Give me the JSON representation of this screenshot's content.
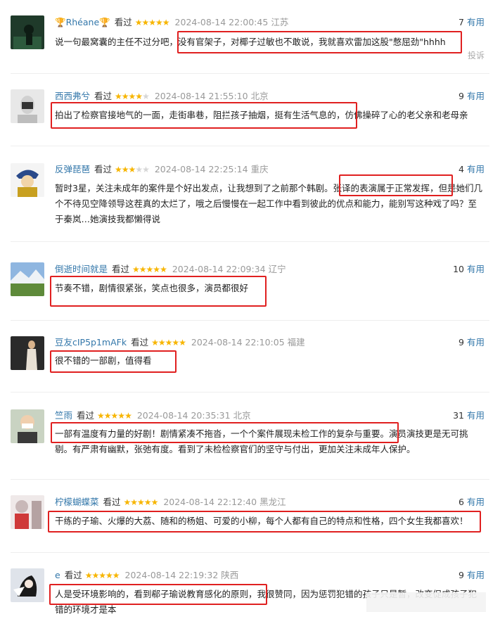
{
  "comments": [
    {
      "user": "Rhéane",
      "badge_icons": [
        "trophy-icon",
        "trophy-icon"
      ],
      "status": "看过",
      "stars": 5,
      "time": "2024-08-14 22:00:45",
      "location": "江苏",
      "useful_count": "7",
      "useful_label": "有用",
      "text": "说一句最窝囊的主任不过分吧，没有官架子，对椰子过敏也不敢说，我就喜欢雷加这股\"憋屈劲\"hhhh",
      "report": "投诉"
    },
    {
      "user": "西西弗兮",
      "status": "看过",
      "stars": 4,
      "time": "2024-08-14 21:55:10",
      "location": "北京",
      "useful_count": "9",
      "useful_label": "有用",
      "text": "拍出了检察官接地气的一面，走街串巷，阻拦孩子抽烟，挺有生活气息的，仿佛操碎了心的老父亲和老母亲"
    },
    {
      "user": "反弹琵琶",
      "status": "看过",
      "stars": 3,
      "time": "2024-08-14 22:25:14",
      "location": "重庆",
      "useful_count": "4",
      "useful_label": "有用",
      "text": "暂时3星，关注未成年的案件是个好出发点，让我想到了之前那个韩剧。张译的表演属于正常发挥，但是她们几个不待见空降领导这茬真的太烂了，哦之后慢慢在一起工作中看到彼此的优点和能力，能别写这种戏了吗？至于秦岚…她演技我都懒得说"
    },
    {
      "user": "倒逝时间就是",
      "status": "看过",
      "stars": 5,
      "time": "2024-08-14 22:09:34",
      "location": "辽宁",
      "useful_count": "10",
      "useful_label": "有用",
      "text": "节奏不错，剧情很紧张，笑点也很多，演员都很好"
    },
    {
      "user": "豆友cIP5p1mAFk",
      "status": "看过",
      "stars": 5,
      "time": "2024-08-14 22:10:05",
      "location": "福建",
      "useful_count": "9",
      "useful_label": "有用",
      "text": "很不错的一部剧，值得看"
    },
    {
      "user": "竺雨",
      "status": "看过",
      "stars": 5,
      "time": "2024-08-14 20:35:31",
      "location": "北京",
      "useful_count": "31",
      "useful_label": "有用",
      "text": "一部有温度有力量的好剧！剧情紧凑不拖沓，一个个案件展现未检工作的复杂与重要。演员演技更是无可挑剔。有严肃有幽默，张弛有度。看到了未检检察官们的坚守与付出，更加关注未成年人保护。"
    },
    {
      "user": "柠檬蝴蝶菜",
      "status": "看过",
      "stars": 5,
      "time": "2024-08-14 22:12:40",
      "location": "黑龙江",
      "useful_count": "6",
      "useful_label": "有用",
      "text": "干练的子瑜、火爆的大荔、随和的杨姐、可爱的小柳，每个人都有自己的特点和性格，四个女生我都喜欢！"
    },
    {
      "user": "e",
      "status": "看过",
      "stars": 5,
      "time": "2024-08-14 22:19:32",
      "location": "陕西",
      "useful_count": "9",
      "useful_label": "有用",
      "text": "人是受环境影响的，看到郗子瑜说教育感化的原则，我很赞同，因为惩罚犯错的孩子只是暂，改变促成孩子犯错的环境才是本"
    }
  ],
  "colors": {
    "username": "#3377aa",
    "star_on": "#f7b500",
    "star_off": "#d6d6d6",
    "highlight_box": "#e02020",
    "meta_gray": "#999999"
  }
}
